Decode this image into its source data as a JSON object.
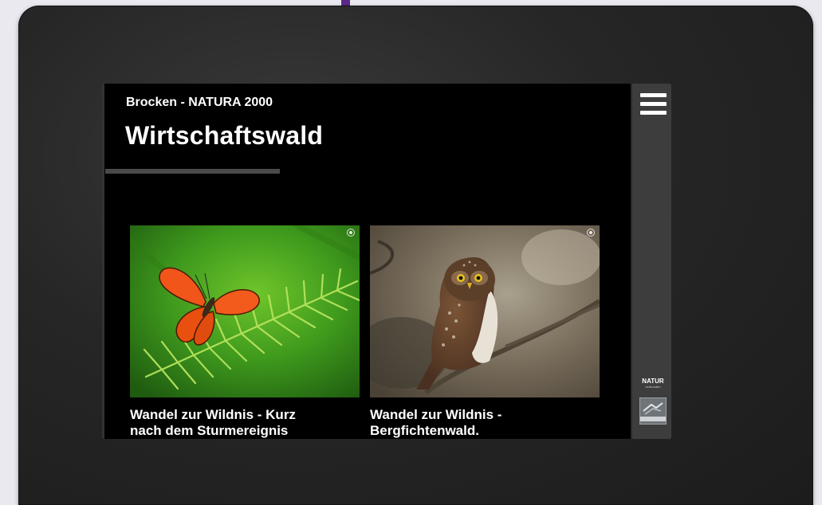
{
  "site": {
    "area_label": "Brocken - NATURA 2000",
    "page_title": "Wirtschaftswald"
  },
  "cards": [
    {
      "image": "butterfly-on-spruce-photo",
      "caption_line1": "Wandel zur Wildnis - Kurz",
      "caption_line2": "nach dem Sturmereignis"
    },
    {
      "image": "pygmy-owl-on-branch-photo",
      "caption_line1": "Wandel zur Wildnis -",
      "caption_line2": "Bergfichtenwald."
    }
  ],
  "sidebar": {
    "menu_icon": "hamburger-menu-icon",
    "partner_logo_text": "NATUR",
    "partner_logo_sub": "verbunden",
    "second_logo": "partner-emblem-icon"
  },
  "colors": {
    "screen_background": "#000000",
    "sidebar_background": "#3d3d3d",
    "underline": "#4a4a4a",
    "text": "#ffffff"
  }
}
